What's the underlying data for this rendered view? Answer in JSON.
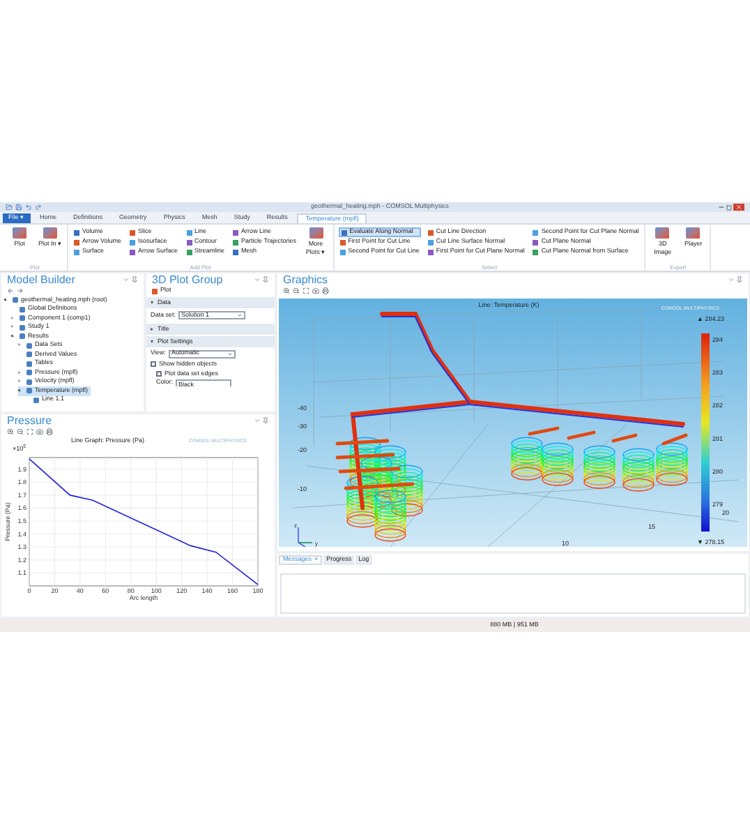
{
  "window": {
    "title": "geothermal_heating.mph - COMSOL Multiphysics"
  },
  "menu_tabs": [
    {
      "label": "File ▾",
      "kind": "file",
      "selected": false
    },
    {
      "label": "Home",
      "kind": "tab",
      "selected": false
    },
    {
      "label": "Definitions",
      "kind": "tab",
      "selected": false
    },
    {
      "label": "Geometry",
      "kind": "tab",
      "selected": false
    },
    {
      "label": "Physics",
      "kind": "tab",
      "selected": false
    },
    {
      "label": "Mesh",
      "kind": "tab",
      "selected": false
    },
    {
      "label": "Study",
      "kind": "tab",
      "selected": false
    },
    {
      "label": "Results",
      "kind": "tab",
      "selected": false
    },
    {
      "label": "Temperature (mpfl)",
      "kind": "tab",
      "selected": true
    }
  ],
  "ribbon": {
    "groups": [
      {
        "label": "Plot",
        "columns": [
          [
            {
              "kind": "large",
              "label": "Plot"
            }
          ],
          [
            {
              "kind": "large",
              "label": "Plot In ▾"
            }
          ]
        ]
      },
      {
        "label": "Add Plot",
        "columns": [
          [
            {
              "kind": "small",
              "label": "Volume"
            },
            {
              "kind": "small",
              "label": "Arrow Volume"
            },
            {
              "kind": "small",
              "label": "Surface"
            }
          ],
          [
            {
              "kind": "small",
              "label": "Slice"
            },
            {
              "kind": "small",
              "label": "Isosurface"
            },
            {
              "kind": "small",
              "label": "Arrow Surface"
            }
          ],
          [
            {
              "kind": "small",
              "label": "Line"
            },
            {
              "kind": "small",
              "label": "Contour"
            },
            {
              "kind": "small",
              "label": "Streamline"
            }
          ],
          [
            {
              "kind": "small",
              "label": "Arrow Line"
            },
            {
              "kind": "small",
              "label": "Particle Trajectories"
            },
            {
              "kind": "small",
              "label": "Mesh"
            }
          ],
          [
            {
              "kind": "large",
              "label": "More Plots ▾"
            }
          ]
        ]
      },
      {
        "label": "Select",
        "columns": [
          [
            {
              "kind": "small",
              "label": "Evaluate Along Normal",
              "selected": true
            },
            {
              "kind": "small",
              "label": "First Point for Cut Line",
              "selected": false
            },
            {
              "kind": "small",
              "label": "Second Point for Cut Line",
              "selected": false
            }
          ],
          [
            {
              "kind": "small",
              "label": "Cut Line Direction",
              "selected": false
            },
            {
              "kind": "small",
              "label": "Cut Line Surface Normal",
              "selected": false
            },
            {
              "kind": "small",
              "label": "First Point for Cut Plane Normal",
              "selected": false
            }
          ],
          [
            {
              "kind": "small",
              "label": "Second Point for Cut Plane Normal",
              "selected": false
            },
            {
              "kind": "small",
              "label": "Cut Plane Normal",
              "selected": false
            },
            {
              "kind": "small",
              "label": "Cut Plane Normal from Surface",
              "selected": false
            }
          ]
        ]
      },
      {
        "label": "Export",
        "columns": [
          [
            {
              "kind": "large",
              "label": "3D Image"
            }
          ],
          [
            {
              "kind": "large",
              "label": "Player"
            }
          ]
        ]
      }
    ]
  },
  "model_builder": {
    "title": "Model Builder",
    "tree": [
      {
        "label": "geothermal_heating.mph (root)",
        "expanded": true,
        "selected": false,
        "children": [
          {
            "label": "Global Definitions",
            "selected": false
          },
          {
            "label": "Component 1 (comp1)",
            "expanded": false,
            "selected": false
          },
          {
            "label": "Study 1",
            "expanded": false,
            "selected": false
          },
          {
            "label": "Results",
            "expanded": true,
            "selected": false,
            "children": [
              {
                "label": "Data Sets",
                "expanded": false,
                "selected": false
              },
              {
                "label": "Derived Values",
                "selected": false
              },
              {
                "label": "Tables",
                "selected": false
              },
              {
                "label": "Pressure (mpfl)",
                "expanded": false,
                "selected": false
              },
              {
                "label": "Velocity (mpfl)",
                "expanded": false,
                "selected": false
              },
              {
                "label": "Temperature (mpfl)",
                "expanded": true,
                "selected": true,
                "children": [
                  {
                    "label": "Line 1.1",
                    "selected": false
                  }
                ]
              }
            ]
          }
        ]
      }
    ]
  },
  "plot_group": {
    "title": "3D Plot Group",
    "plot_button": "Plot",
    "sections": [
      {
        "label": "Data",
        "expanded": true
      },
      {
        "label": "Title",
        "expanded": false
      },
      {
        "label": "Plot Settings",
        "expanded": true
      }
    ],
    "data_set": {
      "label": "Data set:",
      "value": "Solution 1"
    },
    "view": {
      "label": "View:",
      "value": "Automatic"
    },
    "checkboxes": [
      {
        "label": "Show hidden objects",
        "checked": false
      },
      {
        "label": "Plot data set edges",
        "checked": true
      }
    ],
    "color": {
      "label": "Color:",
      "value": "Black"
    }
  },
  "pressure": {
    "title": "Pressure",
    "logo": "COMSOL MULTIPHYSICS",
    "exponent": "×10$^{5}$",
    "chart_data": {
      "type": "line",
      "title": "Line Graph: Pressure (Pa)",
      "xlabel": "Arc length",
      "ylabel": "Pressure (Pa)",
      "x": [
        0,
        32,
        50,
        127,
        147,
        180
      ],
      "grid": true,
      "series": [
        {
          "color": "#1f1fe0",
          "values": [
            1.98,
            1.7,
            1.66,
            1.31,
            1.26,
            1.01
          ]
        }
      ],
      "xlim": [
        0,
        180
      ],
      "ylim": [
        1.0,
        1.99
      ],
      "xticks": [
        0,
        20,
        40,
        60,
        80,
        100,
        120,
        140,
        160,
        180
      ],
      "yticks": [
        1.1,
        1.2,
        1.3,
        1.4,
        1.5,
        1.6,
        1.7,
        1.8,
        1.9
      ]
    }
  },
  "graphics": {
    "title": "Graphics",
    "plot_title": "Line: Temperature (K)",
    "logo": "COMSOL MULTIPHYSICS",
    "z_ticks": [
      "-40",
      "-30",
      "-20",
      "-10"
    ],
    "x_ticks": [
      "10",
      "15",
      "20"
    ],
    "triad": [
      "z",
      "y"
    ],
    "legend": {
      "max": "▲ 284.23",
      "min": "▼ 278.15",
      "ticks": [
        "284",
        "283",
        "282",
        "281",
        "280",
        "279"
      ]
    }
  },
  "messages": {
    "tabs": [
      {
        "label": "Messages",
        "selected": true,
        "close": "×"
      },
      {
        "label": "Progress",
        "selected": false
      },
      {
        "label": "Log",
        "selected": false
      }
    ]
  },
  "status_bar": {
    "memory": "880 MB | 951 MB"
  }
}
